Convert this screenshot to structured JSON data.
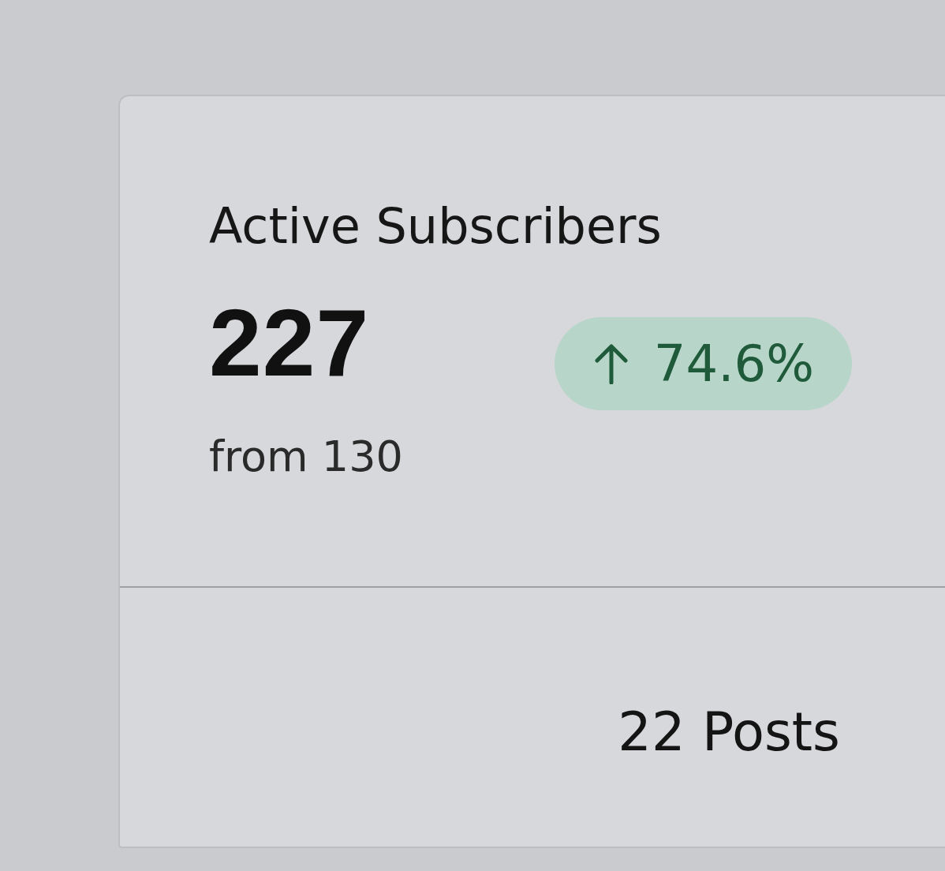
{
  "card": {
    "title": "Active Subscribers",
    "value": "227",
    "comparison": "from 130",
    "change": {
      "kind": "up",
      "text": "74.6%"
    }
  },
  "footer": {
    "posts": "22 Posts"
  }
}
